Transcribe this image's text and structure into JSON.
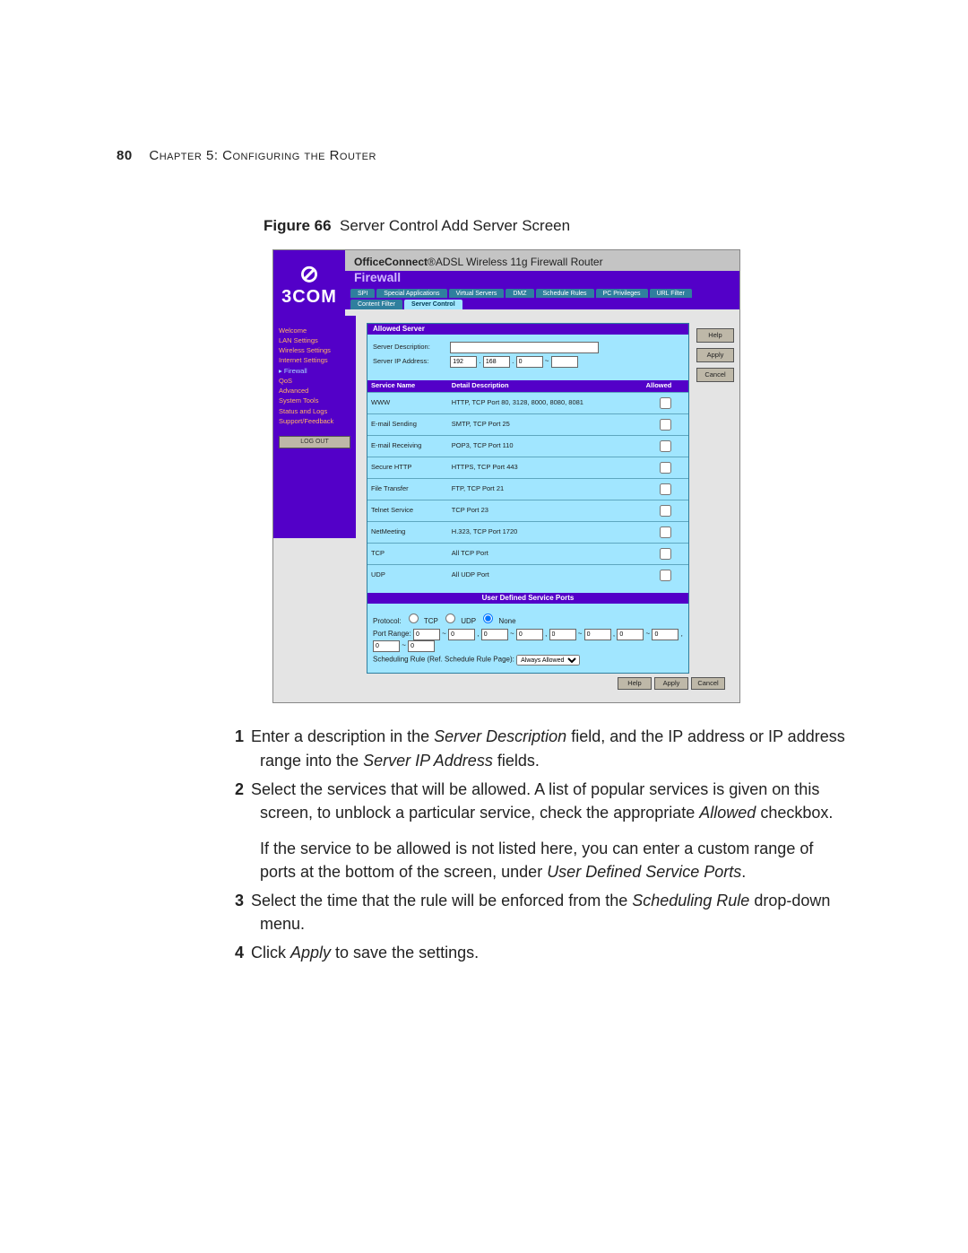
{
  "header": {
    "page_no": "80",
    "chapter": "Chapter 5: Configuring the Router"
  },
  "figure": {
    "label": "Figure 66",
    "caption": "Server Control Add Server Screen"
  },
  "shot": {
    "logo": "3COM",
    "brand": {
      "oc": "OfficeConnect",
      "suffix": "®ADSL Wireless 11g Firewall Router"
    },
    "section": "Firewall",
    "tabs_row1": [
      "SPI",
      "Special Applications",
      "Virtual Servers",
      "DMZ",
      "Schedule Rules"
    ],
    "tabs_row2": [
      "PC Privileges",
      "URL Filter",
      "Content Filter",
      "Server Control"
    ],
    "active_tab": "Server Control",
    "side_items": [
      "Welcome",
      "LAN Settings",
      "Wireless Settings",
      "Internet Settings",
      "Firewall",
      "QoS",
      "Advanced",
      "System Tools",
      "Status and Logs",
      "Support/Feedback"
    ],
    "side_current": "Firewall",
    "logout": "LOG OUT",
    "panel_title": "Allowed Server",
    "lbl_desc": "Server Description:",
    "lbl_ip": "Server IP Address:",
    "ip": [
      "192",
      "168",
      "0",
      ""
    ],
    "th": [
      "Service Name",
      "Detail Description",
      "Allowed"
    ],
    "services": [
      {
        "n": "WWW",
        "d": "HTTP, TCP Port 80, 3128, 8000, 8080, 8081"
      },
      {
        "n": "E-mail Sending",
        "d": "SMTP, TCP Port 25"
      },
      {
        "n": "E-mail Receiving",
        "d": "POP3, TCP Port 110"
      },
      {
        "n": "Secure HTTP",
        "d": "HTTPS, TCP Port 443"
      },
      {
        "n": "File Transfer",
        "d": "FTP, TCP Port 21"
      },
      {
        "n": "Telnet Service",
        "d": "TCP Port 23"
      },
      {
        "n": "NetMeeting",
        "d": "H.323, TCP Port 1720"
      },
      {
        "n": "TCP",
        "d": "All TCP Port"
      },
      {
        "n": "UDP",
        "d": "All UDP Port"
      }
    ],
    "user_ports_title": "User Defined Service Ports",
    "lbl_proto": "Protocol:",
    "proto": [
      "TCP",
      "UDP",
      "None"
    ],
    "lbl_range": "Port Range:",
    "range_vals": [
      "0",
      "0",
      "0",
      "0",
      "0",
      "0",
      "0",
      "0",
      "0",
      "0"
    ],
    "lbl_sched": "Scheduling Rule (Ref. Schedule Rule Page):",
    "sched_value": "Always Allowed",
    "side_btns": [
      "Help",
      "Apply",
      "Cancel"
    ],
    "bottom_btns": [
      "Help",
      "Apply",
      "Cancel"
    ]
  },
  "instr": [
    {
      "n": "1",
      "html": "Enter a description in the <span class='it'>Server Description</span> field, and the IP address or IP address range into the <span class='it'>Server IP Address</span> fields."
    },
    {
      "n": "2",
      "html": "Select the services that will be allowed. A list of popular services is given on this screen, to unblock a particular service, check the appropriate <span class='it'>Allowed</span> checkbox.",
      "extra": "If the service to be allowed is not listed here, you can enter a custom range of ports at the bottom of the screen, under <span class='it'>User Defined Service Ports</span>."
    },
    {
      "n": "3",
      "html": "Select the time that the rule will be enforced from the <span class='it'>Scheduling Rule</span> drop-down menu."
    },
    {
      "n": "4",
      "html": "Click <span class='it'>Apply</span> to save the settings."
    }
  ]
}
